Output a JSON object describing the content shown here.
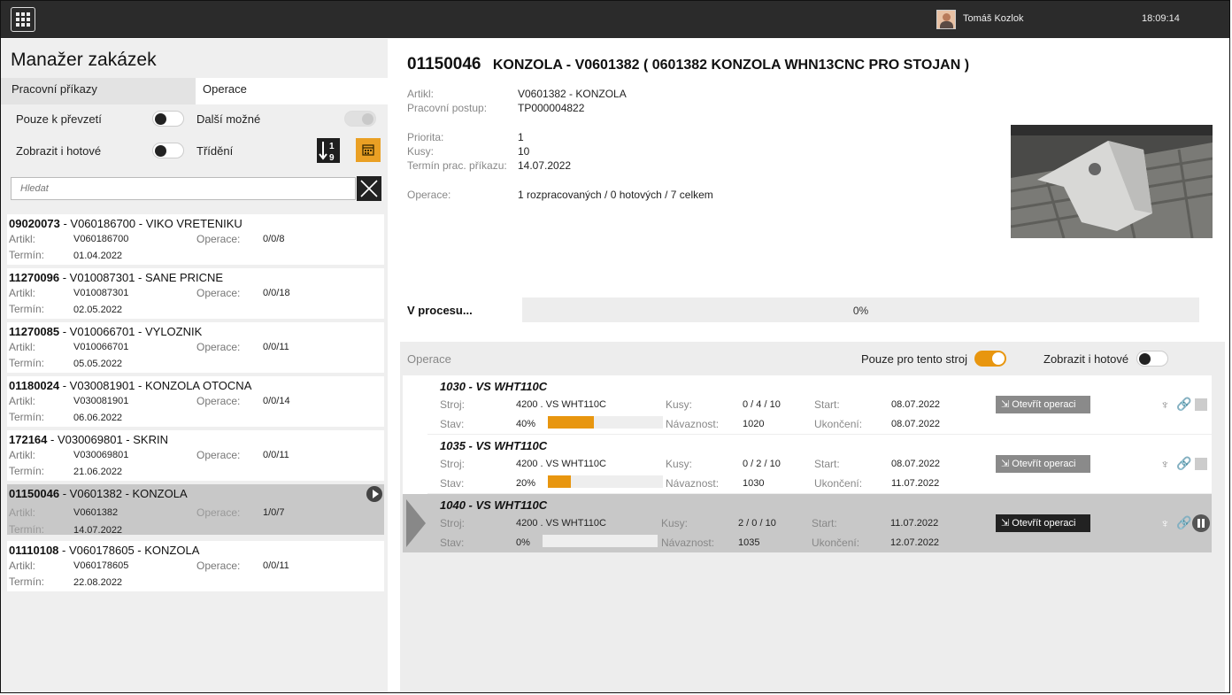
{
  "topbar": {
    "user": "Tomáš Kozlok",
    "time": "18:09:14"
  },
  "left": {
    "title": "Manažer zakázek",
    "tabs": [
      "Pracovní příkazy",
      "Operace"
    ],
    "options": {
      "only_takeover": "Pouze k převzetí",
      "more_possible": "Další možné",
      "show_done": "Zobrazit i hotové",
      "sort": "Třídění"
    },
    "search_placeholder": "Hledat",
    "labels": {
      "article": "Artikl:",
      "deadline": "Termín:",
      "operations": "Operace:"
    },
    "orders": [
      {
        "id": "09020073",
        "rest": " - V060186700 - VIKO VRETENIKU",
        "article": "V060186700",
        "deadline": "01.04.2022",
        "ops": "0/0/8"
      },
      {
        "id": "11270096",
        "rest": " - V010087301 - SANE PRICNE",
        "article": "V010087301",
        "deadline": "02.05.2022",
        "ops": "0/0/18"
      },
      {
        "id": "11270085",
        "rest": " - V010066701 - VYLOZNIK",
        "article": "V010066701",
        "deadline": "05.05.2022",
        "ops": "0/0/11"
      },
      {
        "id": "01180024",
        "rest": " - V030081901 - KONZOLA OTOCNA",
        "article": "V030081901",
        "deadline": "06.06.2022",
        "ops": "0/0/14"
      },
      {
        "id": "172164",
        "rest": " - V030069801 - SKRIN",
        "article": "V030069801",
        "deadline": "21.06.2022",
        "ops": "0/0/11"
      },
      {
        "id": "01150046",
        "rest": " - V0601382 - KONZOLA",
        "article": "V0601382",
        "deadline": "14.07.2022",
        "ops": "1/0/7"
      },
      {
        "id": "01110108",
        "rest": " - V060178605 - KONZOLA",
        "article": "V060178605",
        "deadline": "22.08.2022",
        "ops": "0/0/11"
      }
    ]
  },
  "detail": {
    "number": "01150046",
    "title": "KONZOLA - V0601382 ( 0601382 KONZOLA WHN13CNC PRO STOJAN )",
    "article_label": "Artikl:",
    "article": "V0601382 - KONZOLA",
    "routing_label": "Pracovní postup:",
    "routing": "TP000004822",
    "priority_label": "Priorita:",
    "priority": "1",
    "pieces_label": "Kusy:",
    "pieces": "10",
    "deadline_label": "Termín prac. příkazu:",
    "deadline": "14.07.2022",
    "operations_label": "Operace:",
    "operations": "1 rozpracovaných / 0 hotových / 7 celkem",
    "in_process_label": "V procesu...",
    "progress_text": "0%",
    "progress": 0
  },
  "ops_panel": {
    "title": "Operace",
    "only_this_machine": "Pouze pro tento stroj",
    "show_done": "Zobrazit i hotové",
    "labels": {
      "machine": "Stroj:",
      "state": "Stav:",
      "pieces": "Kusy:",
      "sequence": "Návaznost:",
      "start": "Start:",
      "end": "Ukončení:"
    },
    "open_button": "Otevřít operaci",
    "operations": [
      {
        "name": "1030 - VS WHT110C",
        "machine": "4200 . VS WHT110C",
        "state": "40%",
        "progress": 0.4,
        "pieces": "0 / 4 / 10",
        "sequence": "1020",
        "start": "08.07.2022",
        "end": "08.07.2022"
      },
      {
        "name": "1035 - VS WHT110C",
        "machine": "4200 . VS WHT110C",
        "state": "20%",
        "progress": 0.2,
        "pieces": "0 / 2 / 10",
        "sequence": "1030",
        "start": "08.07.2022",
        "end": "11.07.2022"
      },
      {
        "name": "1040 - VS WHT110C",
        "machine": "4200 . VS WHT110C",
        "state": "0%",
        "progress": 0,
        "pieces": "2 / 0 / 10",
        "sequence": "1035",
        "start": "11.07.2022",
        "end": "12.07.2022"
      }
    ]
  },
  "colors": {
    "accent": "#e8960f",
    "topbar": "#2b2b2b",
    "selected": "#c8c8c8"
  }
}
